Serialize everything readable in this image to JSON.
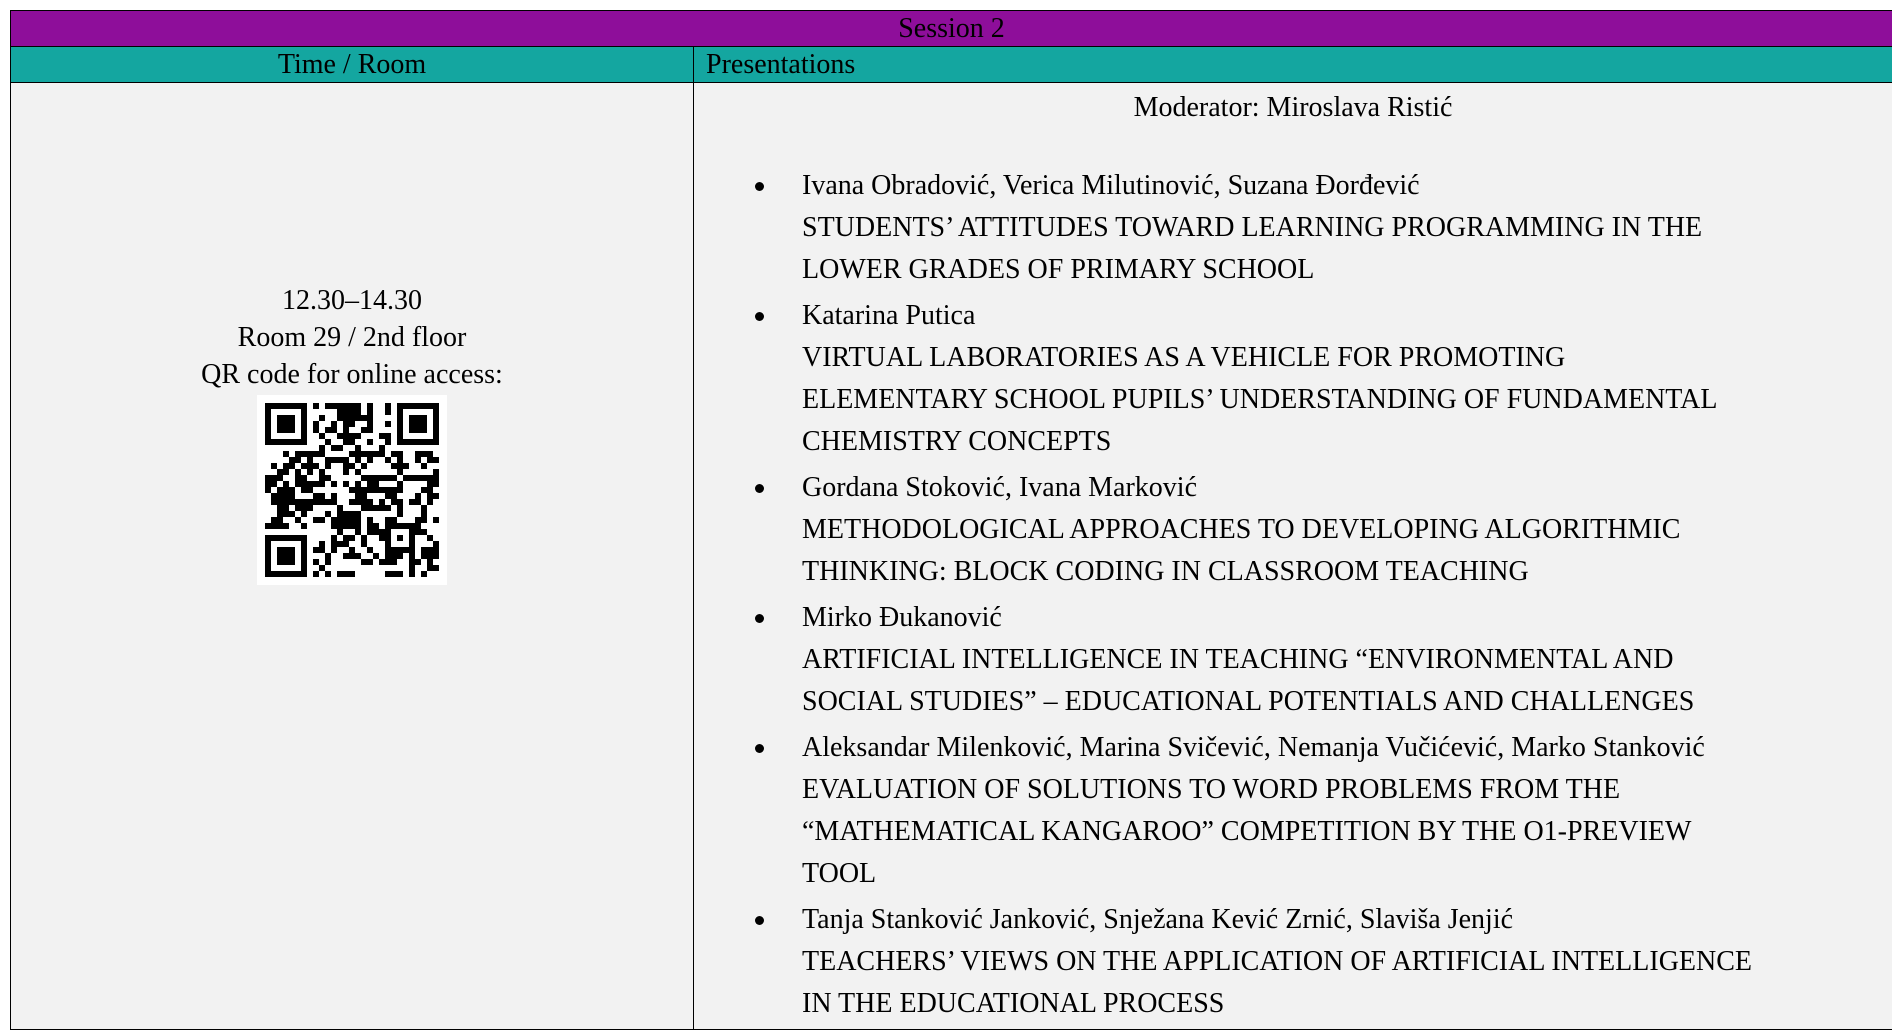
{
  "session": {
    "title": "Session 2",
    "title_bg": "#8e0e9a"
  },
  "headers": {
    "time_room": "Time / Room",
    "presentations": "Presentations",
    "bg": "#14a6a0"
  },
  "time_room": {
    "time": "12.30–14.30",
    "room": "Room 29 / 2nd floor",
    "qr_label": "QR code for online access:",
    "qr_icon": "qr-code-icon"
  },
  "moderator": "Moderator: Miroslava Ristić",
  "presentations": [
    {
      "authors": "Ivana Obradović, Verica Milutinović, Suzana Đorđević",
      "title_lines": [
        "STUDENTS’ ATTITUDES TOWARD LEARNING PROGRAMMING IN THE",
        "LOWER GRADES OF PRIMARY SCHOOL"
      ]
    },
    {
      "authors": "Katarina Putica",
      "title_lines": [
        "VIRTUAL LABORATORIES AS A VEHICLE FOR PROMOTING",
        "ELEMENTARY SCHOOL PUPILS’ UNDERSTANDING OF FUNDAMENTAL",
        "CHEMISTRY CONCEPTS"
      ]
    },
    {
      "authors": "Gordana Stoković, Ivana Marković",
      "title_lines": [
        "METHODOLOGICAL APPROACHES TO DEVELOPING ALGORITHMIC",
        "THINKING: BLOCK CODING IN CLASSROOM TEACHING"
      ]
    },
    {
      "authors": "Mirko Đukanović",
      "title_lines": [
        "ARTIFICIAL INTELLIGENCE IN TEACHING “ENVIRONMENTAL AND",
        "SOCIAL STUDIES” – EDUCATIONAL POTENTIALS AND CHALLENGES"
      ]
    },
    {
      "authors": "Aleksandar Milenković, Marina Svičević, Nemanja Vučićević, Marko Stanković",
      "title_lines": [
        "EVALUATION OF SOLUTIONS TO WORD PROBLEMS FROM THE",
        "“MATHEMATICAL KANGAROO” COMPETITION BY THE O1-PREVIEW",
        "TOOL"
      ]
    },
    {
      "authors": "Tanja Stanković Janković, Snježana Kević Zrnić, Slaviša Jenjić",
      "title_lines": [
        "TEACHERS’ VIEWS ON THE APPLICATION OF ARTIFICIAL INTELLIGENCE",
        "IN THE EDUCATIONAL PROCESS"
      ]
    }
  ]
}
